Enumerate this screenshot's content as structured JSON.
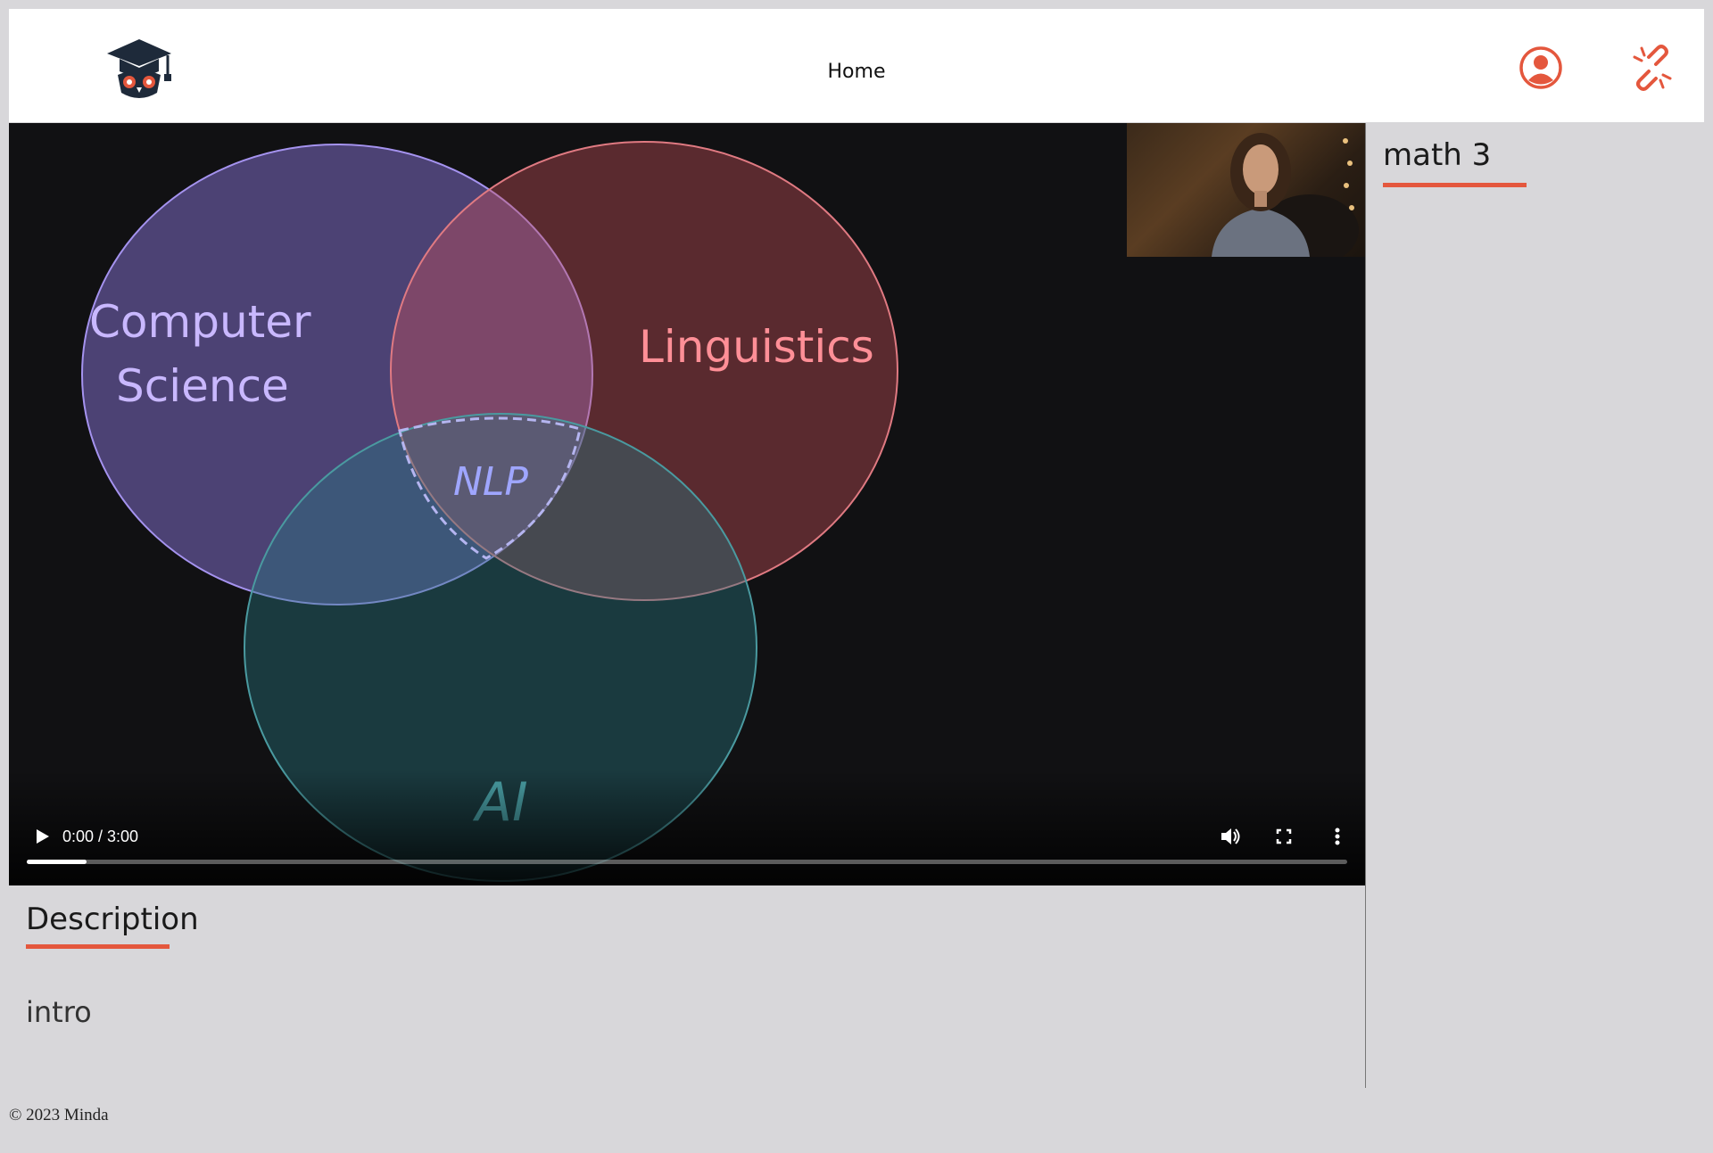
{
  "header": {
    "nav_home_label": "Home",
    "logo_icon": "graduation-owl-logo",
    "user_icon": "user-circle-icon",
    "link_icon": "broken-link-icon"
  },
  "video": {
    "slide_labels": {
      "computer_science_line1": "Computer",
      "computer_science_line2": "Science",
      "linguistics": "Linguistics",
      "nlp": "NLP",
      "ai": "AI"
    },
    "time_display": "0:00 / 3:00",
    "progress_fraction": 0.045
  },
  "sidebar": {
    "course_title": "math 3"
  },
  "description": {
    "heading": "Description",
    "text": "intro"
  },
  "footer": {
    "copyright": "© 2023 Minda"
  },
  "colors": {
    "accent": "#e4573d",
    "page_background": "#d8d7da",
    "video_background": "#111113",
    "circle_cs": "#8e79e0",
    "circle_linguistics": "#e16a72",
    "circle_ai": "#3a8a8a"
  }
}
